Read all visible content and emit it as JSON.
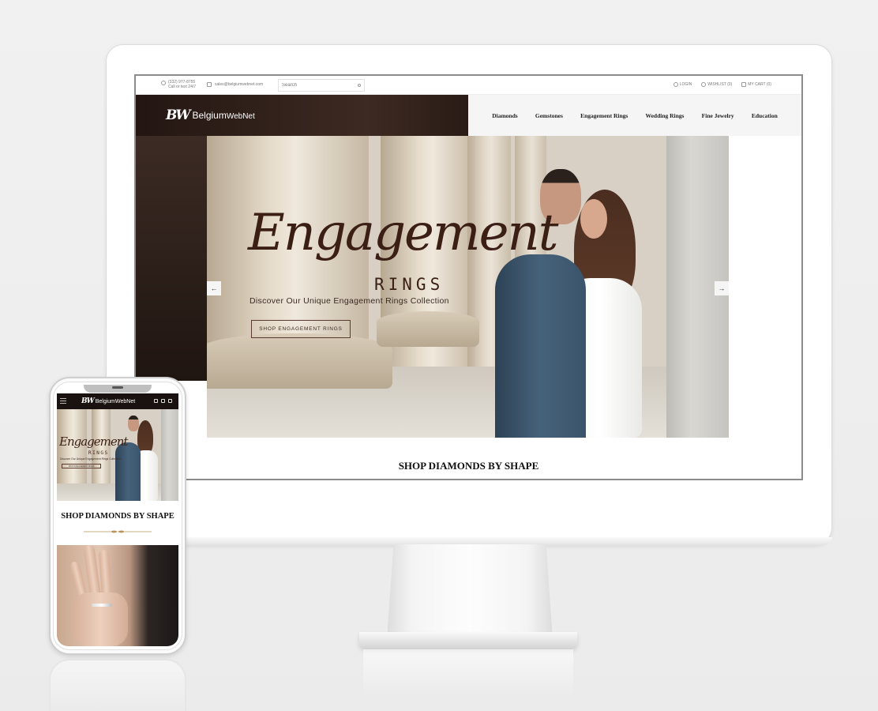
{
  "desktop": {
    "topbar": {
      "phone_number": "(332) 977-8755",
      "phone_note": "Call or text 24/7",
      "email": "sales@belgiumwebnet.com",
      "search_placeholder": "Search",
      "login": "LOGIN",
      "wishlist": "WISHLIST (0)",
      "cart": "MY CART (0)"
    },
    "logo": {
      "mark": "BW",
      "name": "Belgium",
      "name2": "WebNet"
    },
    "nav": [
      "Diamonds",
      "Gemstones",
      "Engagement Rings",
      "Wedding Rings",
      "Fine Jewelry",
      "Education"
    ],
    "hero": {
      "script": "Engagement",
      "rings": "RINGS",
      "subtitle": "Discover Our Unique Engagement Rings Collection",
      "button": "SHOP ENGAGEMENT RINGS",
      "prev": "←",
      "next": "→"
    },
    "section_title": "SHOP DIAMONDS BY SHAPE"
  },
  "mobile": {
    "logo": {
      "mark": "BW",
      "name": "Belgium",
      "name2": "WebNet"
    },
    "hero": {
      "script": "Engagement",
      "rings": "RINGS",
      "subtitle": "Discover Our Unique Engagement Rings Collection",
      "button": "SHOP ENGAGEMENT RINGS"
    },
    "section_title": "SHOP DIAMONDS BY SHAPE"
  },
  "colors": {
    "brand_dark": "#231612",
    "accent_brown": "#3b1e14",
    "ornament_gold": "#b8955a"
  }
}
